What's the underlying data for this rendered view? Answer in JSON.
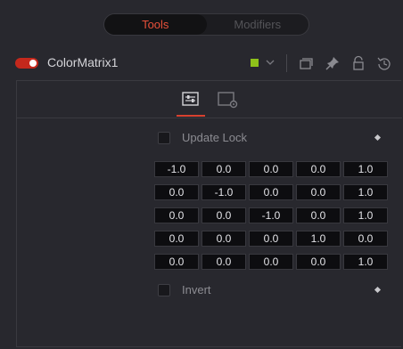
{
  "tabs": [
    {
      "label": "Tools",
      "active": true
    },
    {
      "label": "Modifiers",
      "active": false
    }
  ],
  "header": {
    "node_name": "ColorMatrix1",
    "enabled": true,
    "color_swatch": "#8ec21a",
    "icons": [
      "color-dropdown-icon",
      "versions-icon",
      "pin-icon",
      "lock-icon",
      "reset-icon"
    ]
  },
  "subtabs": [
    {
      "icon": "controls-sliders-icon",
      "active": true
    },
    {
      "icon": "settings-icon",
      "active": false
    }
  ],
  "update_lock": {
    "label": "Update Lock",
    "checked": false
  },
  "matrix": [
    [
      "-1.0",
      "0.0",
      "0.0",
      "0.0",
      "1.0"
    ],
    [
      "0.0",
      "-1.0",
      "0.0",
      "0.0",
      "1.0"
    ],
    [
      "0.0",
      "0.0",
      "-1.0",
      "0.0",
      "1.0"
    ],
    [
      "0.0",
      "0.0",
      "0.0",
      "1.0",
      "0.0"
    ],
    [
      "0.0",
      "0.0",
      "0.0",
      "0.0",
      "1.0"
    ]
  ],
  "invert": {
    "label": "Invert",
    "checked": false
  },
  "colors": {
    "accent": "#e8503a",
    "background": "#28282e"
  }
}
